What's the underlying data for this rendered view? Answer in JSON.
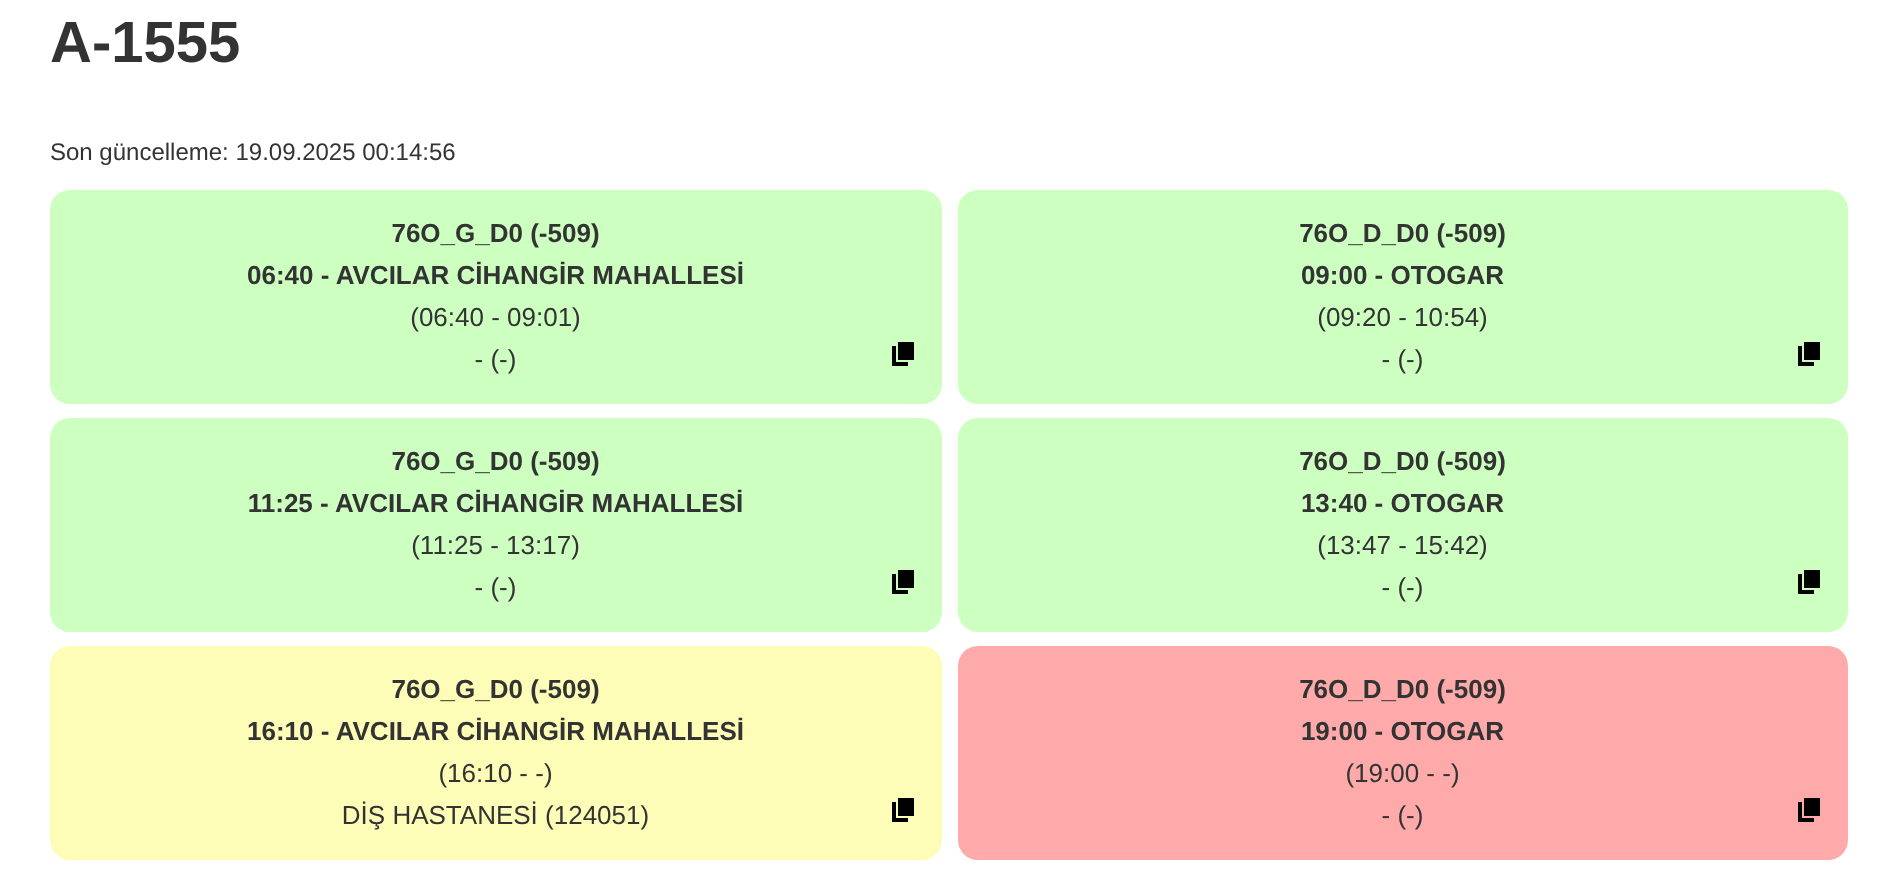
{
  "title": "A-1555",
  "last_update": "Son güncelleme: 19.09.2025 00:14:56",
  "cards": [
    {
      "route": "76O_G_D0 (-509)",
      "departure": "06:40 - AVCILAR CİHANGİR MAHALLESİ",
      "times": "(06:40 - 09:01)",
      "stop": "- (-)",
      "color": "#ccffc0"
    },
    {
      "route": "76O_D_D0 (-509)",
      "departure": "09:00 - OTOGAR",
      "times": "(09:20 - 10:54)",
      "stop": "- (-)",
      "color": "#ccffc0"
    },
    {
      "route": "76O_G_D0 (-509)",
      "departure": "11:25 - AVCILAR CİHANGİR MAHALLESİ",
      "times": "(11:25 - 13:17)",
      "stop": "- (-)",
      "color": "#ccffc0"
    },
    {
      "route": "76O_D_D0 (-509)",
      "departure": "13:40 - OTOGAR",
      "times": "(13:47 - 15:42)",
      "stop": "- (-)",
      "color": "#ccffc0"
    },
    {
      "route": "76O_G_D0 (-509)",
      "departure": "16:10 - AVCILAR CİHANGİR MAHALLESİ",
      "times": "(16:10 - -)",
      "stop": "DİŞ HASTANESİ (124051)",
      "color": "#fdfdb8"
    },
    {
      "route": "76O_D_D0 (-509)",
      "departure": "19:00 - OTOGAR",
      "times": "(19:00 - -)",
      "stop": "- (-)",
      "color": "#ffaaaa"
    }
  ]
}
